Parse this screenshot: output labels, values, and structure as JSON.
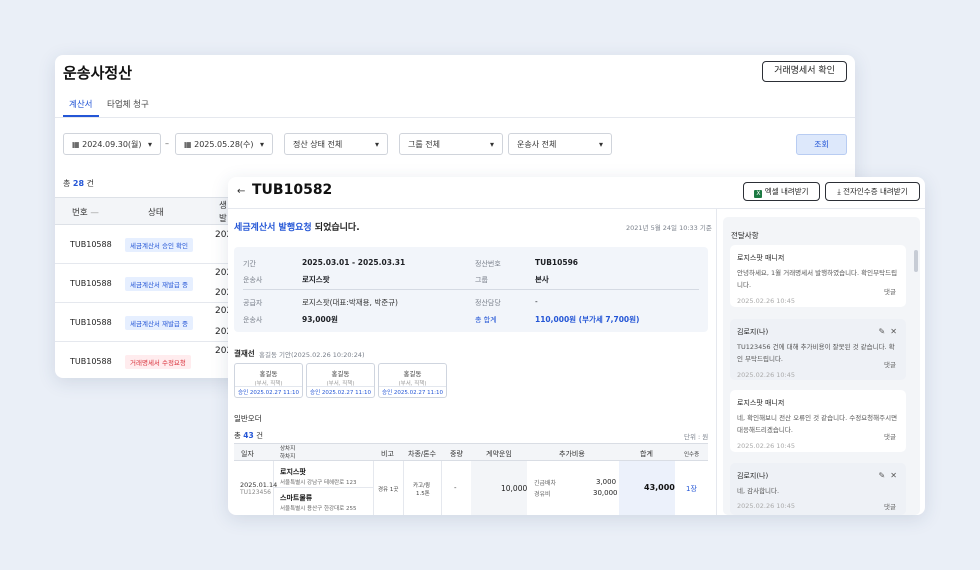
{
  "back": {
    "title": "운송사정산",
    "button": "거래명세서 확인",
    "tabs": [
      "계산서",
      "타업체 청구"
    ],
    "filters": {
      "date_from": "2024.09.30(월)",
      "date_to": "2025.05.28(수)",
      "status": "정산 상태 전체",
      "group": "그룹 전체",
      "carrier": "운송사 전체",
      "search": "조회"
    },
    "count": {
      "prefix": "총",
      "value": "28",
      "suffix": "건"
    },
    "headers": {
      "no": "번호",
      "status": "상태",
      "extra": "생",
      "extra2": "발"
    },
    "rows": [
      {
        "no": "TUB10588",
        "status": "세금계산서 승인 확인",
        "color": "blue",
        "c1": "202"
      },
      {
        "no": "TUB10588",
        "status": "세금계산서 재발급 중",
        "color": "blue",
        "c1": "202",
        "c2": "202"
      },
      {
        "no": "TUB10588",
        "status": "세금계산서 재발급 중",
        "color": "blue",
        "c1": "202",
        "c2": "202"
      },
      {
        "no": "TUB10588",
        "status": "거래명세서 수정요청",
        "color": "red",
        "c1": "202"
      }
    ]
  },
  "front": {
    "title": "TUB10582",
    "btn_excel": "엑셀 내려받기",
    "btn_receipt": "전자인수증 내려받기",
    "banner": {
      "highlight": "세금계산서 발행요청",
      "rest": " 되었습니다.",
      "time": "2021년 5월 24일 10:33 기준"
    },
    "info": {
      "period_l": "기간",
      "period_v": "2025.03.01 - 2025.03.31",
      "no_l": "정산번호",
      "no_v": "TUB10596",
      "carrier_l": "운송사",
      "carrier_v": "로지스팟",
      "group_l": "그룹",
      "group_v": "본사",
      "supplier_l": "공급자",
      "supplier_v": "로지스팟(대표:박재용, 박준규)",
      "manager_l": "정산담당",
      "manager_v": "-",
      "amount_l": "운송사",
      "amount_v": "93,000원",
      "total_l": "총 합계",
      "total_v": "110,000원 (부가세 7,700원)"
    },
    "approval": {
      "label": "결재선",
      "note": "홍길동 기안(2025.02.26 10:20:24)",
      "boxes": [
        {
          "name": "홍길동",
          "role": "(부서, 직책)",
          "stamp": "승인 2025.02.27 11:10"
        },
        {
          "name": "홍길동",
          "role": "(부서, 직책)",
          "stamp": "승인 2025.02.27 11:10"
        },
        {
          "name": "홍길동",
          "role": "(부서, 직책)",
          "stamp": "승인 2025.02.27 11:10"
        }
      ]
    },
    "orders": {
      "label": "일반오더",
      "count_prefix": "총",
      "count": "43",
      "count_suffix": "건",
      "unit": "단위 : 원",
      "headers": {
        "date": "일자",
        "shipper": "상차지",
        "consignee": "하차지",
        "note": "비고",
        "vehicle": "차종/톤수",
        "weight": "중량",
        "contract": "계약운임",
        "extra": "추가비용",
        "sum": "합계",
        "receipt": "인수증"
      },
      "row": {
        "date": "2025.01.14",
        "id": "TU123456",
        "from_name": "로지스팟",
        "from_addr": "서울특별시 강남구 테헤란로 123",
        "to_name": "스마트물류",
        "to_addr": "서울특별시 용산구 한강대로 255",
        "note": "경유 1곳",
        "vehicle1": "카고/윙",
        "vehicle2": "1.5톤",
        "weight": "-",
        "contract": "10,000",
        "extra1_l": "긴급배차",
        "extra1_v": "3,000",
        "extra2_l": "경유비",
        "extra2_v": "30,000",
        "sum": "43,000",
        "receipt": "1장"
      }
    },
    "messages": {
      "title": "전달사항",
      "items": [
        {
          "name": "로지스팟 매니저",
          "text": "안녕하세요, 1월 거래명세서 발행하였습니다. 확인부탁드립니다.",
          "date": "2025.02.26 10:45",
          "reply": "댓글"
        },
        {
          "name": "김로지(나)",
          "text": "TU123456 건에 대해 추가비용이 잘못된 것 같습니다. 확인 부탁드립니다.",
          "date": "2025.02.26 10:45",
          "reply": "댓글"
        },
        {
          "name": "로지스팟 매니저",
          "text": "네, 확인해보니 전산 오류인 것 같습니다. 수정요청해주시면 대응해드리겠습니다.",
          "date": "2025.02.26 10:45",
          "reply": "댓글"
        },
        {
          "name": "김로지(나)",
          "text": "네, 감사합니다.",
          "date": "2025.02.26 10:45",
          "reply": "댓글"
        }
      ]
    }
  }
}
